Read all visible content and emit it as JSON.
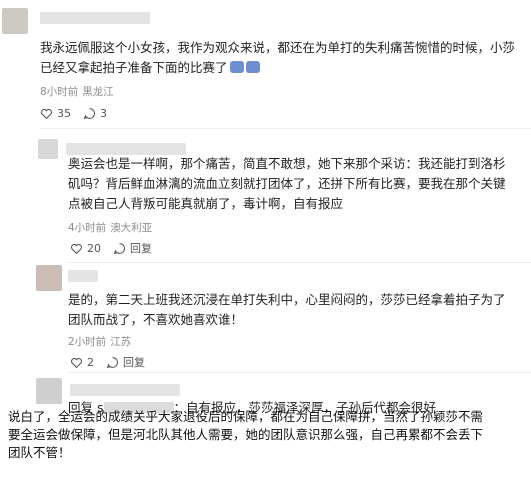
{
  "comments": [
    {
      "text_l1": "我永远佩服这个小女孩，我作为观众来说，都还在为单打的失利痛苦惋惜的时候，小莎",
      "text_l2": "已经又拿起拍子准备下面的比赛了",
      "time": "8小时前",
      "location": "黑龙江",
      "likes": "35",
      "replies": "3"
    },
    {
      "text_l1": "奥运会也是一样啊，那个痛苦，简直不敢想，她下来那个采访：我还能打到洛杉",
      "text_l2": "矶吗？背后鲜血淋漓的流血立刻就打团体了，还拼下所有比赛，要我在那个关键",
      "text_l3": "点被自己人背叛可能真就崩了，毒计啊，自有报应",
      "time": "4小时前",
      "location": "澳大利亚",
      "likes": "20",
      "reply_label": "回复"
    },
    {
      "text_l1": "是的，第二天上班我还沉浸在单打失利中，心里闷闷的，莎莎已经拿着拍子为了",
      "text_l2": "团队而战了，不喜欢她喜欢谁！",
      "time": "2小时前",
      "location": "江苏",
      "likes": "2",
      "reply_label": "回复"
    },
    {
      "reply_prefix": "回复",
      "masked_name_start": "s",
      "text": "：自有报应，莎莎福泽深厚，子孙后代都会很好"
    }
  ],
  "bottom_text": {
    "l1": "说白了，全运会的成绩关乎大家退役后的保障，都在为自己保障拼，当然了孙颖莎不需",
    "l2": "要全运会做保障，但是河北队其他人需要，她的团队意识那么强，自己再累都不会丢下",
    "l3": "团队不管！"
  },
  "icons": [
    "like-icon",
    "comment-icon",
    "reply-icon"
  ]
}
